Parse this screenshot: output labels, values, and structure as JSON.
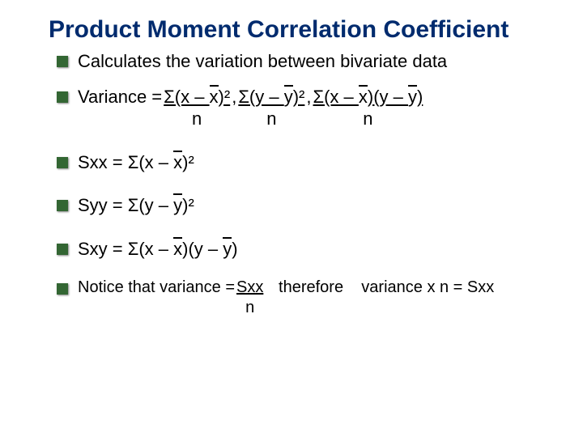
{
  "title": "Product Moment Correlation Coefficient",
  "subtitle": "Calculates the variation between bivariate data",
  "variance_label": "Variance = ",
  "frac1_num_a": "Σ(x – ",
  "frac1_num_b": "x",
  "frac1_num_c": ")²",
  "sep1": " , ",
  "frac2_num_a": "Σ(y – ",
  "frac2_num_b": "y",
  "frac2_num_c": ")²",
  "sep2": " , ",
  "frac3_num_a": "Σ(x – ",
  "frac3_num_b": "x",
  "frac3_num_c": ")(y – ",
  "frac3_num_d": "y",
  "frac3_num_e": ")",
  "den": "n",
  "sxx_a": "Sxx = Σ(x – ",
  "sxx_b": "x",
  "sxx_c": ")²",
  "syy_a": "Syy = Σ(y – ",
  "syy_b": "y",
  "syy_c": ")²",
  "sxy_a": "Sxy = Σ(x – ",
  "sxy_b": "x",
  "sxy_c": ")(y – ",
  "sxy_d": "y",
  "sxy_e": ")",
  "note_a": "Notice that variance = ",
  "note_frac_num": "Sxx",
  "note_b": "   therefore    variance x n = Sxx",
  "note_den": "n"
}
